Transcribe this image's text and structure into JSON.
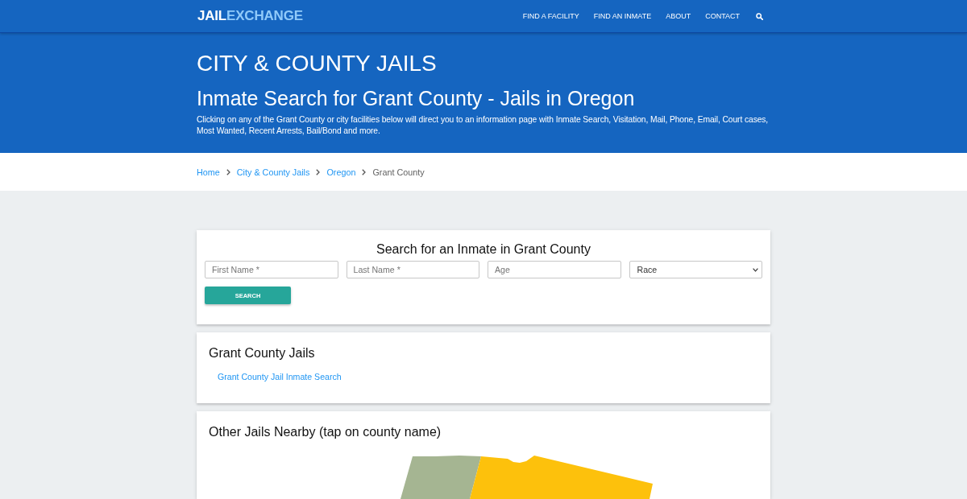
{
  "navbar": {
    "logo": {
      "first": "JAIL",
      "second": "EXCHANGE"
    },
    "links": [
      "FIND A FACILITY",
      "FIND AN INMATE",
      "ABOUT",
      "CONTACT"
    ]
  },
  "hero": {
    "kicker": "CITY & COUNTY JAILS",
    "title": "Inmate Search for Grant County - Jails in Oregon",
    "description": "Clicking on any of the Grant County or city facilities below will direct you to an information page with Inmate Search, Visitation, Mail, Phone, Email, Court cases, Most Wanted, Recent Arrests, Bail/Bond and more."
  },
  "breadcrumb": [
    {
      "label": "Home",
      "kind": "link"
    },
    {
      "label": "City & County Jails",
      "kind": "link"
    },
    {
      "label": "Oregon",
      "kind": "link"
    },
    {
      "label": "Grant County",
      "kind": "current"
    }
  ],
  "search_form": {
    "title": "Search for an Inmate in Grant County",
    "fields": [
      {
        "kind": "text",
        "placeholder": "First Name *"
      },
      {
        "kind": "text",
        "placeholder": "Last Name *"
      },
      {
        "kind": "text",
        "placeholder": "Age"
      },
      {
        "kind": "select",
        "value": "Race"
      }
    ],
    "button": "SEARCH"
  },
  "county_jails": {
    "title": "Grant County Jails",
    "links": [
      "Grant County Jail Inmate Search"
    ]
  },
  "nearby": {
    "title": "Other Jails Nearby (tap on county name)"
  }
}
